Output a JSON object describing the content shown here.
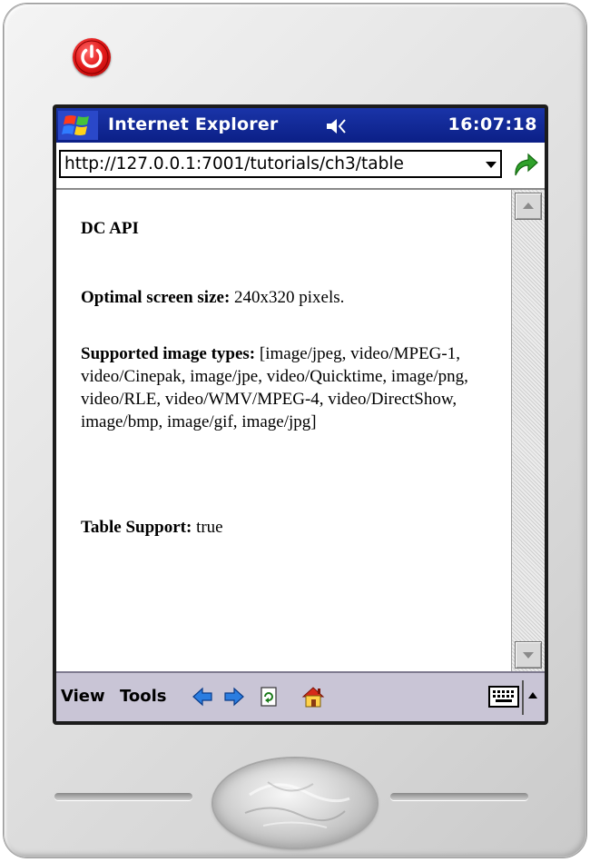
{
  "window": {
    "app_title": "Internet Explorer",
    "clock": "16:07:18"
  },
  "address_bar": {
    "url": "http://127.0.0.1:7001/tutorials/ch3/table"
  },
  "content": {
    "heading": "DC API",
    "screen_size_label": "Optimal screen size:",
    "screen_size_value": "240x320 pixels.",
    "image_types_label": "Supported image types:",
    "image_types_value": "[image/jpeg, video/MPEG-1, video/Cinepak, image/jpe, video/Quicktime, image/png, video/RLE, video/WMV/MPEG-4, video/DirectShow, image/bmp, image/gif, image/jpg]",
    "table_support_label": "Table Support:",
    "table_support_value": "true"
  },
  "command_bar": {
    "view_label": "View",
    "tools_label": "Tools"
  },
  "icons": {
    "power": "power-icon",
    "start": "windows-flag-icon",
    "sound": "speaker-icon",
    "go": "go-arrow-icon",
    "back": "back-arrow-icon",
    "forward": "forward-arrow-icon",
    "refresh": "refresh-icon",
    "home": "home-icon",
    "keyboard": "keyboard-icon"
  },
  "colors": {
    "titlebar": "#0b1f86",
    "command_bar": "#c9c5d6",
    "power_button": "#e41b1b"
  }
}
